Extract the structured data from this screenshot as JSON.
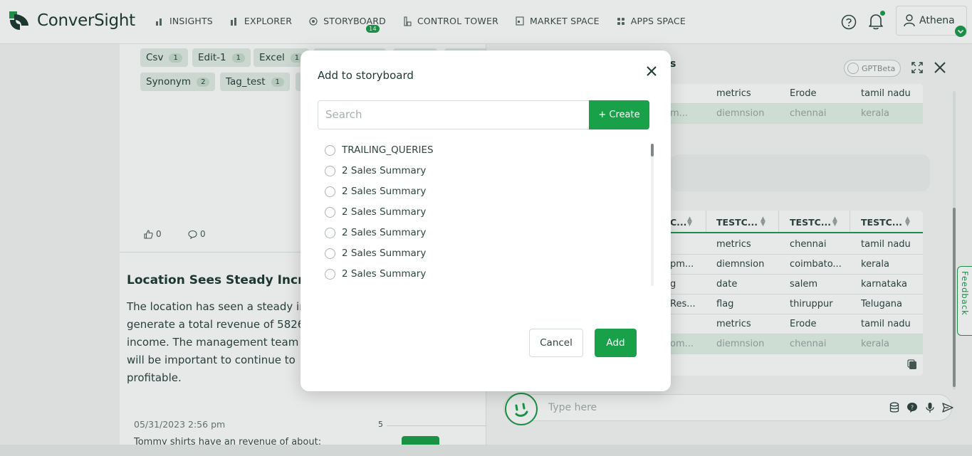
{
  "app": {
    "brand": "ConverSight"
  },
  "nav": {
    "items": [
      {
        "label": "INSIGHTS"
      },
      {
        "label": "EXPLORER"
      },
      {
        "label": "STORYBOARD",
        "badge": "14"
      },
      {
        "label": "CONTROL TOWER"
      },
      {
        "label": "MARKET SPACE"
      },
      {
        "label": "APPS SPACE"
      }
    ]
  },
  "user": {
    "name": "Athena"
  },
  "tags": [
    {
      "label": "Csv",
      "count": "1"
    },
    {
      "label": "Edit-1",
      "count": "1"
    },
    {
      "label": "Excel",
      "count": "1"
    },
    {
      "label": "Synonym",
      "count": "2"
    },
    {
      "label": "Tag_test",
      "count": "1"
    }
  ],
  "feed": {
    "likes": "0",
    "comments": "0",
    "insight_title": "Location Sees Steady Increase",
    "insight_body": [
      "The location has seen a steady in",
      "generate a total revenue of 5826",
      "income. The management team",
      "will be important to continue to",
      "profitable."
    ],
    "date": "05/31/2023 2:56 pm",
    "chart_tick": "5",
    "preview_text": "Tommy shirts have an revenue of about:"
  },
  "right_panel": {
    "title_fragment": "s",
    "gpt_toggle_label": "GPTBeta",
    "top_table": {
      "rows": [
        [
          "metrics",
          "Erode",
          "tamil nadu"
        ],
        [
          "m...",
          "diemnsion",
          "chennai",
          "kerala"
        ]
      ]
    },
    "table": {
      "headers": [
        "C...",
        "TESTC...",
        "TESTC...",
        "TESTC..."
      ],
      "rows": [
        [
          "",
          "metrics",
          "chennai",
          "tamil nadu"
        ],
        [
          "pm...",
          "diemnsion",
          "coimbato...",
          "kerala"
        ],
        [
          "g",
          "date",
          "salem",
          "karnataka"
        ],
        [
          "Res...",
          "flag",
          "thiruppur",
          "Telugana"
        ],
        [
          "",
          "metrics",
          "Erode",
          "tamil nadu"
        ],
        [
          "om...",
          "diemnsion",
          "chennai",
          "kerala"
        ]
      ]
    },
    "feedback_label": "Feedback",
    "chat_placeholder": "Type here"
  },
  "modal": {
    "title": "Add to storyboard",
    "search_placeholder": "Search",
    "create_label": "+ Create",
    "items": [
      "TRAILING_QUERIES",
      "2 Sales Summary",
      "2 Sales Summary",
      "2 Sales Summary",
      "2 Sales Summary",
      "2 Sales Summary",
      "2 Sales Summary"
    ],
    "cancel_label": "Cancel",
    "add_label": "Add"
  },
  "colors": {
    "accent": "#19a149",
    "text": "#1d3933"
  }
}
